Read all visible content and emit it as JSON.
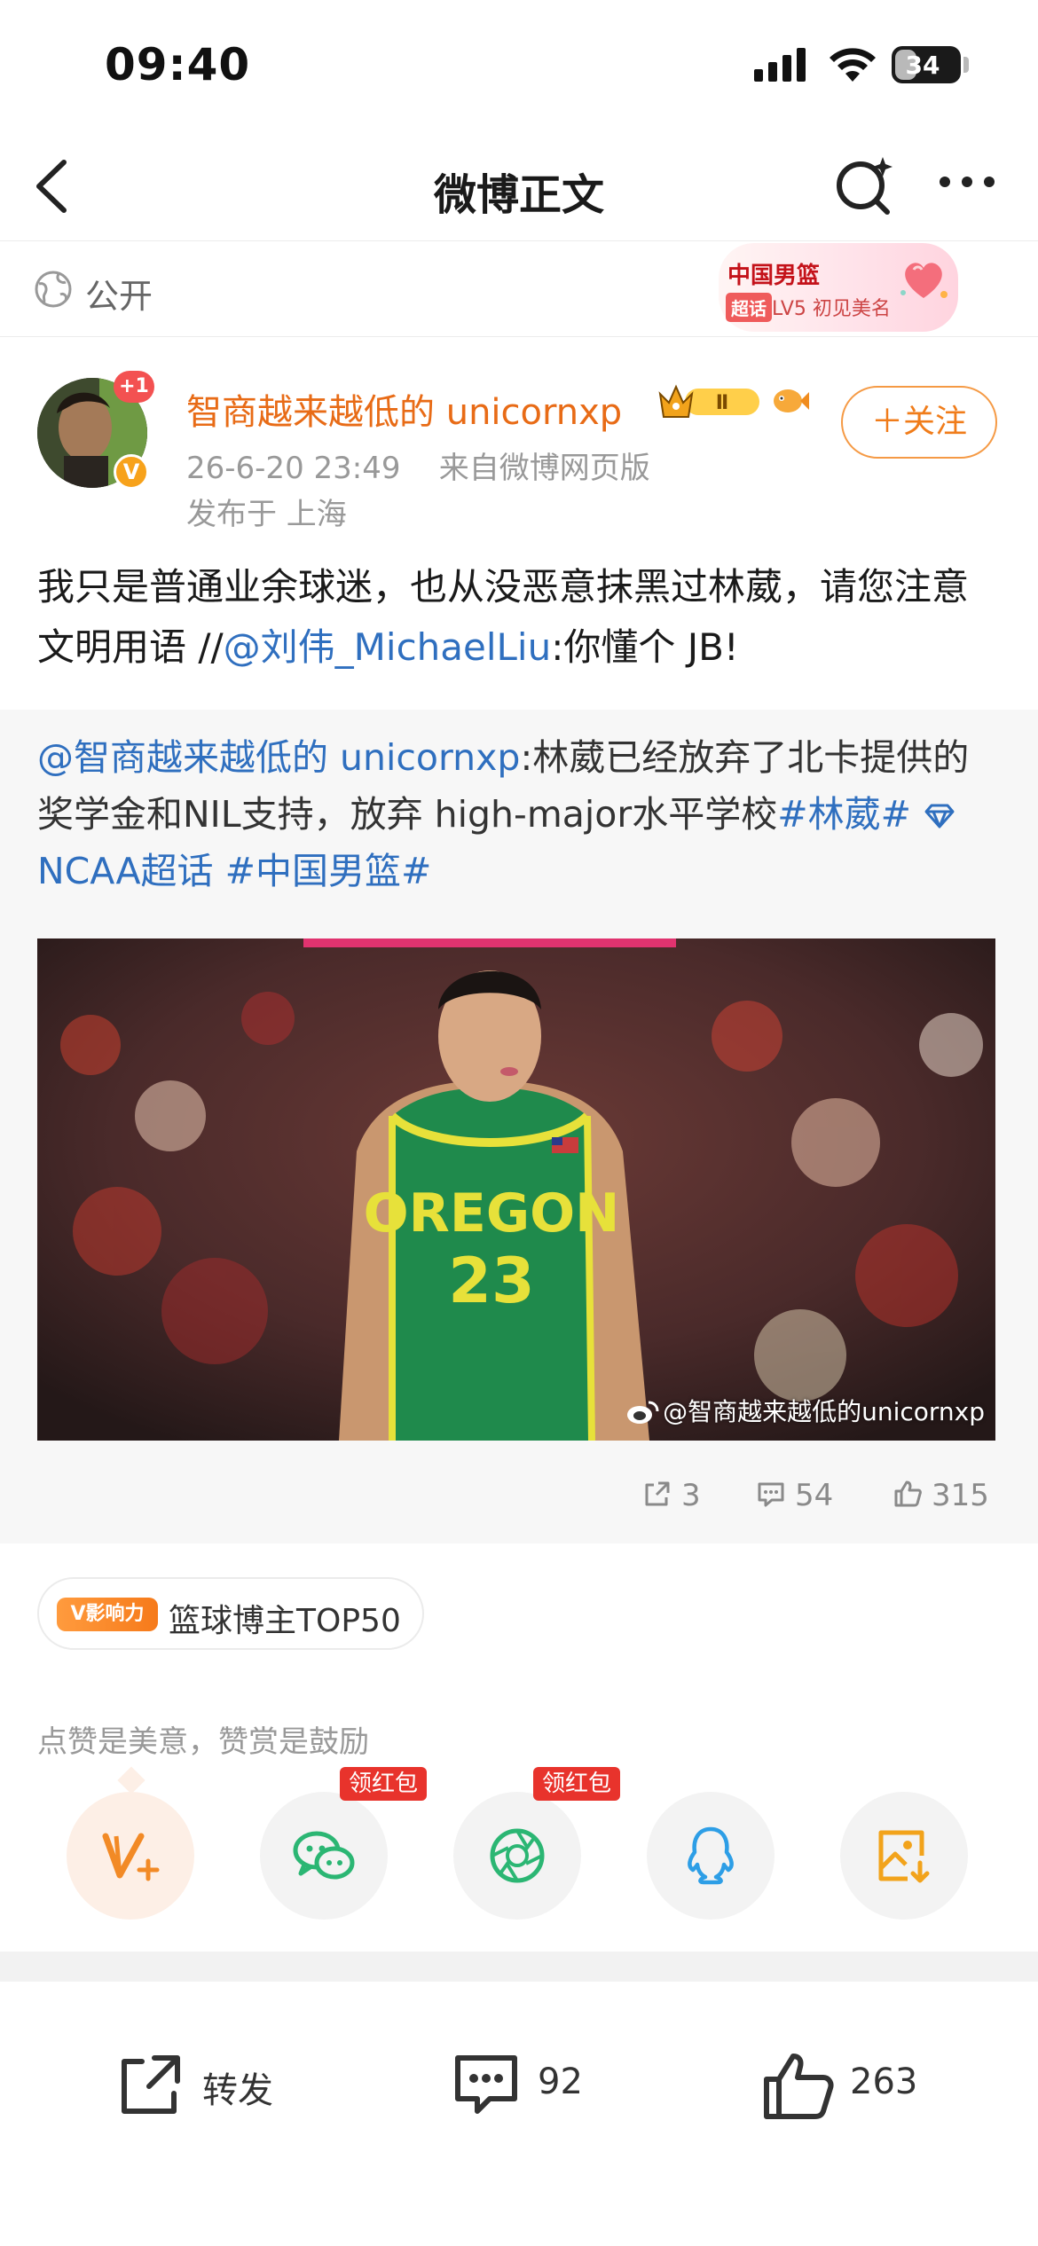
{
  "status_bar": {
    "time": "09:40",
    "battery": "34",
    "battery_level": 0.34,
    "icons": [
      "signal-icon",
      "wifi-icon",
      "battery-icon"
    ]
  },
  "nav": {
    "title": "微博正文",
    "icons": [
      "back-icon",
      "search-spark-icon",
      "more-icon"
    ]
  },
  "privacy": {
    "label": "公开",
    "icon": "globe-icon"
  },
  "chaohua_card": {
    "title": "中国男篮",
    "badge": "超话",
    "level": "LV5 初见美名"
  },
  "author": {
    "name": "智商越来越低的 unicornxp",
    "avatar_badge": "+1",
    "verified_mark": "V",
    "vip_level": "Ⅱ",
    "time": "26-6-20 23:49",
    "source": "来自微博网页版",
    "location": "发布于 上海",
    "follow_label": "＋关注"
  },
  "post": {
    "text": "我只是普通业余球迷，也从没恶意抹黑过林葳，请您注意文明用语 //",
    "mention": "@刘伟_MichaelLiu",
    "quote": ":你懂个 JB!"
  },
  "repost": {
    "mention": "@智商越来越低的 unicornxp",
    "text": ":林葳已经放弃了北卡提供的奖学金和NIL支持，放弃 high-major水平学校",
    "tag1": "#林葳#",
    "tag2": "NCAA超话",
    "tag3": "#中国男篮#",
    "image": {
      "jersey_word": "OREGON",
      "jersey_number": "23",
      "watermark": "@智商越来越低的unicornxp"
    },
    "stats": {
      "reposts": "3",
      "comments": "54",
      "likes": "315"
    }
  },
  "influence": {
    "badge": "V影响力",
    "label": "篮球博主TOP50"
  },
  "reward_hint": "点赞是美意，赞赏是鼓励",
  "share": {
    "items": [
      {
        "name": "reward",
        "icon": "v-plus-icon"
      },
      {
        "name": "wechat",
        "icon": "wechat-icon",
        "tag": "领红包"
      },
      {
        "name": "moments",
        "icon": "moments-icon",
        "tag": "领红包"
      },
      {
        "name": "qq",
        "icon": "qq-icon"
      },
      {
        "name": "save-image",
        "icon": "save-image-icon"
      }
    ]
  },
  "bottom_bar": {
    "repost_label": "转发",
    "comment_count": "92",
    "like_count": "263"
  },
  "colors": {
    "accent_orange": "#e86b16",
    "link_blue": "#2f6fbf",
    "red": "#e8332c",
    "wechat_green": "#2bb673",
    "qq_blue": "#2d9ee6",
    "gold": "#f2a31b"
  }
}
